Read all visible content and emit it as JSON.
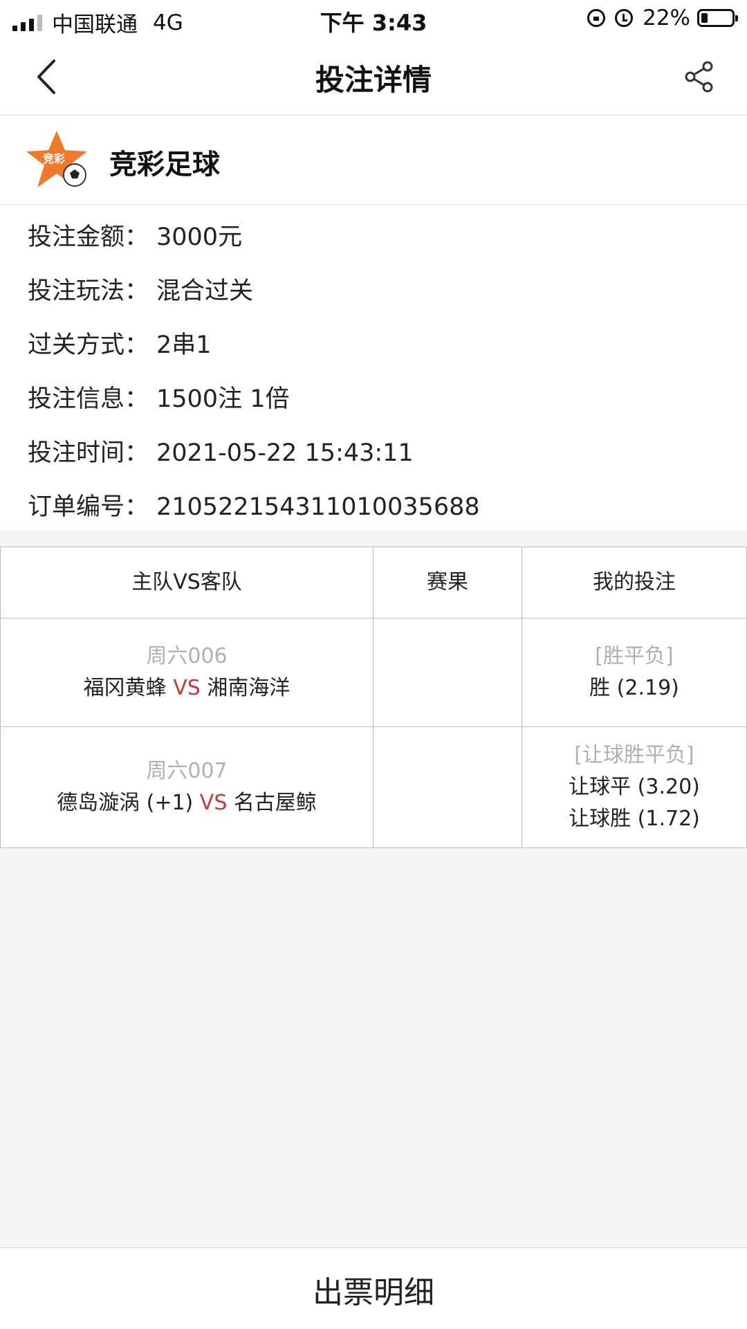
{
  "status_bar": {
    "carrier": "中国联通",
    "network": "4G",
    "time": "下午 3:43",
    "battery_text": "22%",
    "battery_level_percent": 22,
    "icons": [
      "signal-icon",
      "rotation-lock-icon",
      "alarm-icon",
      "battery-icon"
    ]
  },
  "nav": {
    "title": "投注详情",
    "back_icon": "chevron-left-icon",
    "share_icon": "share-icon"
  },
  "lottery": {
    "name": "竞彩足球",
    "logo_text": "竞彩",
    "logo_colors": {
      "star": "#f07a2c",
      "accent": "#ffffff"
    }
  },
  "info": [
    {
      "label": "投注金额：",
      "value": "3000元"
    },
    {
      "label": "投注玩法：",
      "value": "混合过关"
    },
    {
      "label": "过关方式：",
      "value": "2串1"
    },
    {
      "label": "投注信息：",
      "value": "1500注 1倍"
    },
    {
      "label": "投注时间：",
      "value": "2021-05-22 15:43:11"
    },
    {
      "label": "订单编号：",
      "value": "2105221543110100356​88"
    }
  ],
  "table": {
    "headers": [
      "主队VS客队",
      "赛果",
      "我的投注"
    ],
    "rows": [
      {
        "code": "周六006",
        "home": "福冈黄蜂",
        "vs": "VS",
        "away": "湘南海洋",
        "result": "",
        "bet_type": "[胜平负]",
        "bets": [
          "胜 (2.19)"
        ]
      },
      {
        "code": "周六007",
        "home": "德岛漩涡 (+1)",
        "vs": "VS",
        "away": "名古屋鲸",
        "result": "",
        "bet_type": "[让球胜平负]",
        "bets": [
          "让球平 (3.20)",
          "让球胜 (1.72)"
        ]
      }
    ]
  },
  "bottom": {
    "button_label": "出票明细"
  },
  "colors": {
    "vs": "#c23b3b",
    "muted": "#b0b0b0",
    "background": "#f5f5f5"
  }
}
